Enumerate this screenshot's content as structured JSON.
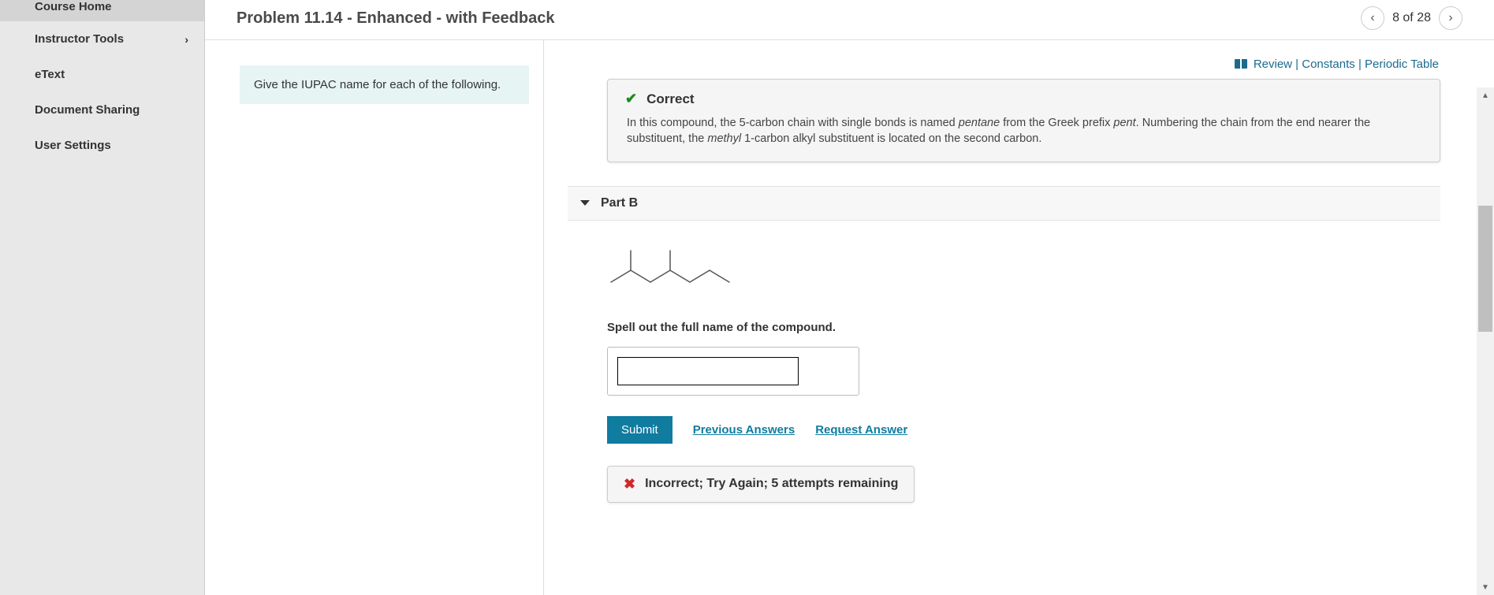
{
  "sidebar": {
    "items": [
      {
        "label": "Course Home",
        "active": true,
        "hasChevron": false
      },
      {
        "label": "Instructor Tools",
        "active": false,
        "hasChevron": true
      },
      {
        "label": "eText",
        "active": false,
        "hasChevron": false
      },
      {
        "label": "Document Sharing",
        "active": false,
        "hasChevron": false
      },
      {
        "label": "User Settings",
        "active": false,
        "hasChevron": false
      }
    ]
  },
  "header": {
    "title": "Problem 11.14 - Enhanced - with Feedback",
    "nav_text": "8 of 28"
  },
  "toplinks": {
    "review": "Review",
    "constants": "Constants",
    "periodic": "Periodic Table"
  },
  "instruction": "Give the IUPAC name for each of the following.",
  "feedback": {
    "status": "Correct",
    "body_prefix": "In this compound, the 5-carbon chain with single bonds is named ",
    "body_em1": "pentane",
    "body_mid1": " from the Greek prefix ",
    "body_em2": "pent",
    "body_mid2": ". Numbering the chain from the end nearer the substituent, the ",
    "body_em3": "methyl",
    "body_suffix": " 1-carbon alkyl substituent is located on the second carbon."
  },
  "partB": {
    "title": "Part B",
    "prompt": "Spell out the full name of the compound.",
    "answer_value": "",
    "submit": "Submit",
    "prev_answers": "Previous Answers",
    "request_answer": "Request Answer",
    "status": "Incorrect; Try Again; 5 attempts remaining"
  }
}
